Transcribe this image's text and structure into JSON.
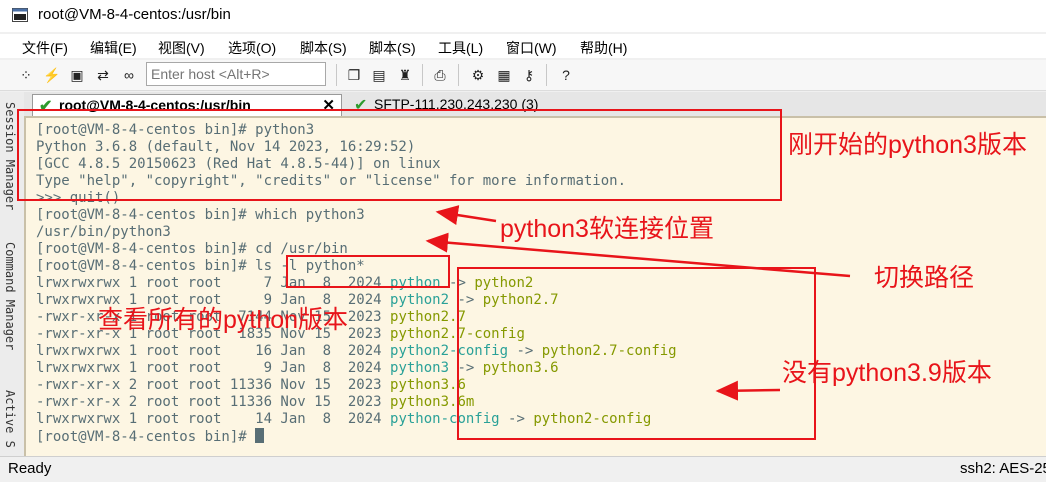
{
  "window": {
    "title": "root@VM-8-4-centos:/usr/bin"
  },
  "menu": [
    "文件(F)",
    "编辑(E)",
    "视图(V)",
    "选项(O)",
    "脚本(S)",
    "脚本(S)",
    "工具(L)",
    "窗口(W)",
    "帮助(H)"
  ],
  "toolbar": {
    "host_placeholder": "Enter host <Alt+R>",
    "icons": [
      "reconnect-icon",
      "lightning-icon",
      "terminal-icon",
      "refresh-icon",
      "link-icon",
      "copy-icon",
      "paste-icon",
      "find-icon",
      "print-icon",
      "settings-icon",
      "keymap-icon",
      "key-icon",
      "help-icon"
    ]
  },
  "side_tabs": [
    "Session Manager",
    "Command Manager",
    "Active S"
  ],
  "tabs": {
    "active": "root@VM-8-4-centos:/usr/bin",
    "inactive": "SFTP-111.230.243.230 (3)"
  },
  "terminal": {
    "lines": [
      {
        "text": "[root@VM-8-4-centos bin]# python3"
      },
      {
        "text": "Python 3.6.8 (default, Nov 14 2023, 16:29:52)"
      },
      {
        "text": "[GCC 4.8.5 20150623 (Red Hat 4.8.5-44)] on linux"
      },
      {
        "text": "Type \"help\", \"copyright\", \"credits\" or \"license\" for more information."
      },
      {
        "text": ">>> quit()"
      },
      {
        "text": "[root@VM-8-4-centos bin]# which python3"
      },
      {
        "text": "/usr/bin/python3"
      },
      {
        "text": "[root@VM-8-4-centos bin]# cd /usr/bin"
      },
      {
        "text": "[root@VM-8-4-centos bin]# ls -l python*"
      },
      {
        "text": "lrwxrwxrwx 1 root root     7 Jan  8  2024 ",
        "link": "python",
        "target": "python2"
      },
      {
        "text": "lrwxrwxrwx 1 root root     9 Jan  8  2024 ",
        "link": "python2",
        "target": "python2.7"
      },
      {
        "text": "-rwxr-xr-x 1 root root  7144 Nov 15  2023 ",
        "exe": "python2.7"
      },
      {
        "text": "-rwxr-xr-x 1 root root  1835 Nov 15  2023 ",
        "exe": "python2.7-config"
      },
      {
        "text": "lrwxrwxrwx 1 root root    16 Jan  8  2024 ",
        "link": "python2-config",
        "target": "python2.7-config"
      },
      {
        "text": "lrwxrwxrwx 1 root root     9 Jan  8  2024 ",
        "link": "python3",
        "target": "python3.6"
      },
      {
        "text": "-rwxr-xr-x 2 root root 11336 Nov 15  2023 ",
        "exe": "python3.6"
      },
      {
        "text": "-rwxr-xr-x 2 root root 11336 Nov 15  2023 ",
        "exe": "python3.6m"
      },
      {
        "text": "lrwxrwxrwx 1 root root    14 Jan  8  2024 ",
        "link": "python-config",
        "target": "python2-config"
      },
      {
        "text": "[root@VM-8-4-centos bin]# ",
        "cursor": true
      }
    ],
    "arrow": " -> "
  },
  "annotations": {
    "initial_version": "刚开始的python3版本",
    "symlink_location": "python3软连接位置",
    "switch_path": "切换路径",
    "view_all": "查看所有的python版本",
    "no_39": "没有python3.9版本",
    "color": "#e8141a"
  },
  "status": {
    "left": "Ready",
    "right": "ssh2: AES-25"
  }
}
